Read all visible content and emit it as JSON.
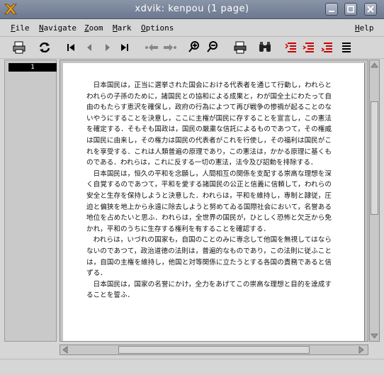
{
  "window": {
    "title": "xdvik:  kenpou   (1 page)"
  },
  "menubar": {
    "file": "File",
    "navigate": "Navigate",
    "zoom": "Zoom",
    "mark": "Mark",
    "options": "Options",
    "help": "Help"
  },
  "toolbar": {
    "icons": [
      "printer-icon",
      "reload-icon",
      "first-page-icon",
      "previous-page-icon",
      "next-page-icon",
      "last-page-icon",
      "back-icon",
      "forward-icon",
      "zoom-in-icon",
      "zoom-out-icon",
      "print-icon",
      "search-icon",
      "mark-first-icon",
      "mark-all-icon",
      "mark-unmark-icon",
      "mark-list-icon"
    ]
  },
  "sidebar": {
    "pages": [
      "1"
    ]
  },
  "document": {
    "paragraphs": [
      "日本国民は，正当に選挙された国会における代表者を通じて行動し，われらとわれらの子孫のために，諸国民との協和による成果と，わが国全土にわたって自由のもたらす恵沢を確保し，政府の行為によつて再び戦争の惨禍が起ることのないやうにすることを決意し，ここに主権が国民に存することを宣言し，この憲法を確定する．そもそも国政は，国民の厳粛な信託によるものであつて，その権威は国民に由来し，その権力は国民の代表者がこれを行使し，その福利は国民がこれを享受する．これは人類普遍の原理であり，この憲法は，かかる原理に基くものである．われらは，これに反する一切の憲法，法令及び詔勅を排除する．",
      "日本国民は，恒久の平和を念願し，人間相互の関係を支配する崇高な理想を深く自覚するのであつて，平和を愛する諸国民の公正と信義に信頼して，われらの安全と生存を保持しようと決意した．われらは，平和を維持し，専制と隷従，圧迫と偏狭を地上から永遠に除去しようと努めてゐる国際社会において，名誉ある地位を占めたいと思ふ．われらは，全世界の国民が，ひとしく恐怖と欠乏から免かれ，平和のうちに生存する権利を有することを確認する．",
      "われらは，いづれの国家も，自国のことのみに専念して他国を無視してはならないのであつて，政治道徳の法則は，普遍的なものであり，この法則に従ふことは，自国の主権を維持し，他国と対等関係に立たうとする各国の責務であると信ずる．",
      "日本国民は，国家の名誉にかけ，全力をあげてこの崇高な理想と目的を達成することを誓ふ．"
    ]
  }
}
